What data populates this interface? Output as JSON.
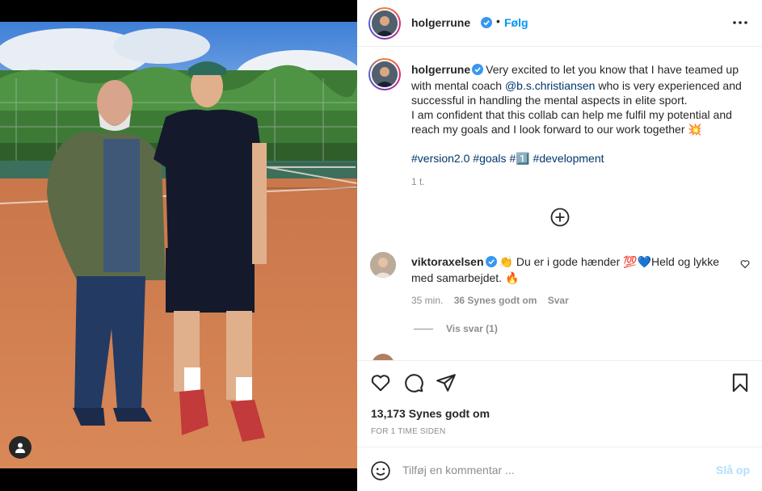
{
  "post": {
    "username": "holgerrune",
    "follow_label": "Følg",
    "dot": "•",
    "caption": {
      "username": "holgerrune",
      "part1": "Very excited to let you know that I have teamed up with mental coach ",
      "mention": "@b.s.christiansen",
      "part2": " who is very experienced and successful in handling the mental aspects in elite sport.",
      "part3": "I am confident that this collab can help me fulfil my potential and reach my goals and I look forward to our work together ",
      "emoji_end": "💥",
      "hashtags": [
        "#version2.0",
        "#goals",
        "#1️⃣",
        "#development"
      ],
      "time": "1 t."
    },
    "comments": [
      {
        "username": "viktoraxelsen",
        "text_part1": " Du er i gode hænder ",
        "emoji_start": "👏",
        "emoji_mid": "💯💙",
        "text_part2": "Held og lykke med samarbejdet. ",
        "emoji_end": "🔥",
        "time": "35 min.",
        "likes": "36 Synes godt om",
        "reply_label": "Svar",
        "view_replies": "Vis svar (1)"
      }
    ],
    "likes_count": "13,173 Synes godt om",
    "post_time": "FOR 1 TIME SIDEN",
    "add_comment_placeholder": "Tilføj en kommentar ...",
    "post_button": "Slå op"
  },
  "colors": {
    "accent": "#0095f6",
    "link": "#00376b",
    "muted": "#8e8e8e",
    "post_disabled": "#b2dffc",
    "verified": "#3897f0"
  },
  "icons": [
    "verified-badge-icon",
    "more-options-icon",
    "add-circle-icon",
    "heart-icon",
    "comment-icon",
    "share-icon",
    "bookmark-icon",
    "emoji-icon",
    "user-tag-icon"
  ]
}
